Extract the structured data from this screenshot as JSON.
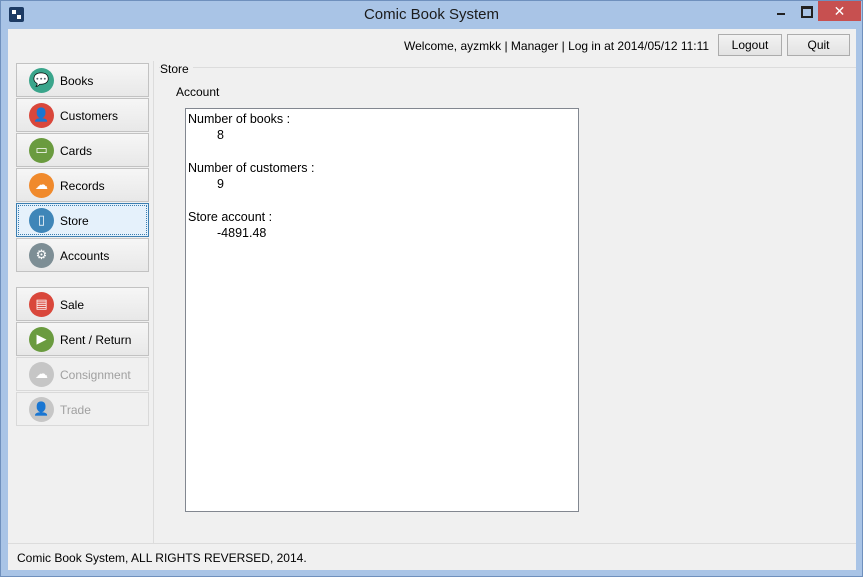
{
  "window": {
    "title": "Comic Book System",
    "close_glyph": "✕",
    "icons": {
      "app": "app-icon",
      "minimize": "minimize-icon",
      "maximize": "maximize-icon",
      "close": "close-icon"
    }
  },
  "header": {
    "welcome_text": "Welcome, ayzmkk | Manager | Log in at 2014/05/12 11:11",
    "logout_label": "Logout",
    "quit_label": "Quit"
  },
  "sidebar": {
    "items": [
      {
        "label": "Books",
        "icon": "chat-bubble-icon",
        "color": "#3aa58b",
        "glyph": "💬",
        "state": "normal"
      },
      {
        "label": "Customers",
        "icon": "user-icon",
        "color": "#d9473b",
        "glyph": "👤",
        "state": "normal"
      },
      {
        "label": "Cards",
        "icon": "monitor-icon",
        "color": "#6a9b3f",
        "glyph": "▭",
        "state": "normal"
      },
      {
        "label": "Records",
        "icon": "cloud-icon",
        "color": "#f08a2c",
        "glyph": "☁",
        "state": "normal"
      },
      {
        "label": "Store",
        "icon": "phone-icon",
        "color": "#3f86b8",
        "glyph": "▯",
        "state": "selected"
      },
      {
        "label": "Accounts",
        "icon": "gear-icon",
        "color": "#7d8e95",
        "glyph": "⚙",
        "state": "normal"
      },
      {
        "label": "Sale",
        "icon": "document-icon",
        "color": "#d9473b",
        "glyph": "▤",
        "state": "normal"
      },
      {
        "label": "Rent / Return",
        "icon": "video-camera-icon",
        "color": "#6a9b3f",
        "glyph": "▶",
        "state": "normal"
      },
      {
        "label": "Consignment",
        "icon": "cloud-icon",
        "color": "#c6c6c6",
        "glyph": "☁",
        "state": "disabled"
      },
      {
        "label": "Trade",
        "icon": "user-icon",
        "color": "#c6c6c6",
        "glyph": "👤",
        "state": "disabled"
      }
    ]
  },
  "main": {
    "group_label": "Store",
    "account_label": "Account",
    "stats": [
      {
        "label": "Number of books :",
        "value": "8"
      },
      {
        "label": "Number of customers :",
        "value": "9"
      },
      {
        "label": "Store account :",
        "value": "-4891.48"
      }
    ]
  },
  "status": {
    "text": "Comic Book System, ALL RIGHTS REVERSED, 2014."
  }
}
